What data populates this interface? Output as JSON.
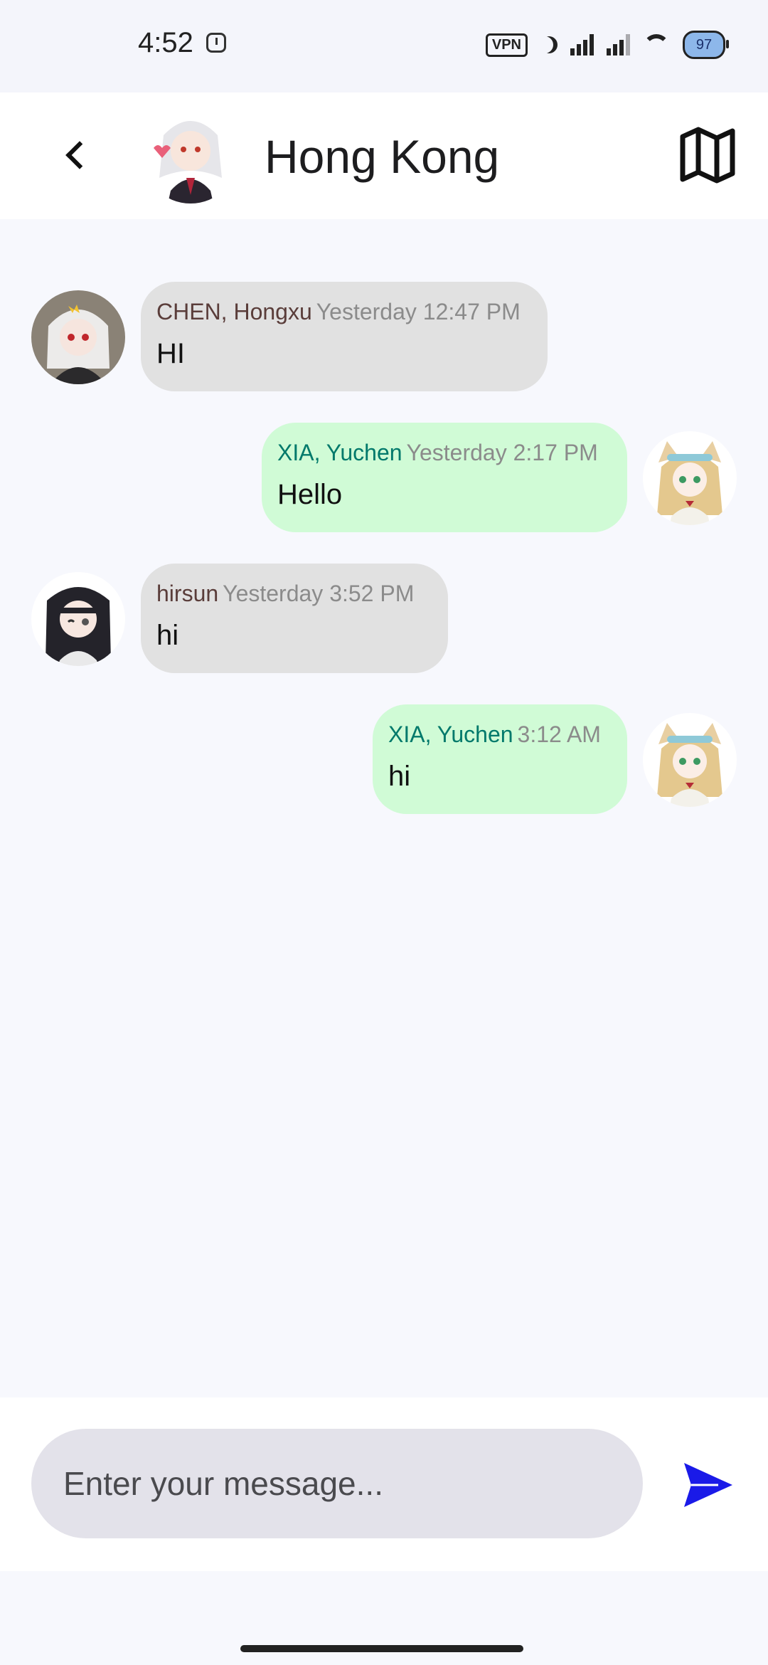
{
  "status_bar": {
    "time": "4:52",
    "vpn": "VPN",
    "battery": "97"
  },
  "header": {
    "title": "Hong Kong"
  },
  "messages": [
    {
      "direction": "in",
      "sender": "CHEN, Hongxu",
      "time": "Yesterday 12:47 PM",
      "text": "HI"
    },
    {
      "direction": "out",
      "sender": "XIA, Yuchen",
      "time": "Yesterday 2:17 PM",
      "text": "Hello"
    },
    {
      "direction": "in",
      "sender": "hirsun",
      "time": "Yesterday 3:52 PM",
      "text": "hi"
    },
    {
      "direction": "out",
      "sender": "XIA, Yuchen",
      "time": "3:12 AM",
      "text": "hi"
    }
  ],
  "composer": {
    "placeholder": "Enter your message..."
  },
  "colors": {
    "incoming_bubble": "#e1e1e1",
    "outgoing_bubble": "#d0fbd6",
    "outgoing_sender": "#00796b",
    "send_icon": "#1a1ae8"
  }
}
